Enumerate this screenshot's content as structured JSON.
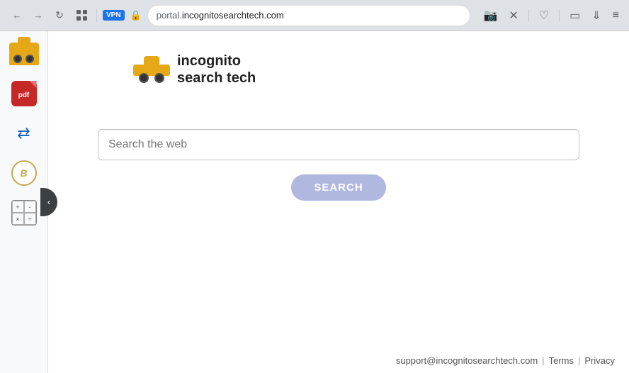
{
  "browser": {
    "url_prefix": "portal.",
    "url_domain": "incognitosearchtech.com",
    "vpn_label": "VPN"
  },
  "sidebar": {
    "icons": [
      {
        "name": "incognito-logo",
        "label": "Incognito Logo"
      },
      {
        "name": "pdf-tool",
        "label": "PDF"
      },
      {
        "name": "arrows-tool",
        "label": "Arrows"
      },
      {
        "name": "bitcoin-tool",
        "label": "Bitcoin"
      },
      {
        "name": "grid-calc-tool",
        "label": "Grid Calculator"
      }
    ],
    "collapse_label": "‹"
  },
  "logo": {
    "line1": "incognito",
    "line2": "search tech"
  },
  "search": {
    "placeholder": "Search the web",
    "button_label": "SEARCH"
  },
  "footer": {
    "email": "support@incognitosearchtech.com",
    "terms_label": "Terms",
    "privacy_label": "Privacy"
  }
}
